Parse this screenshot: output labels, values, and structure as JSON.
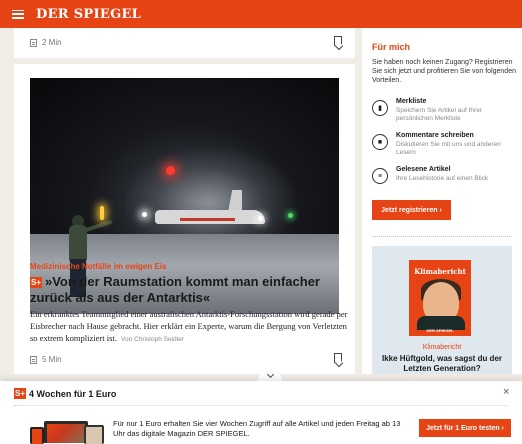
{
  "header": {
    "logo": "DER SPIEGEL",
    "menu_icon": "hamburger-menu-icon",
    "brand_color": "#e64415"
  },
  "top_card": {
    "read_time": "2 Min",
    "bookmark_icon": "bookmark-icon",
    "doc_icon": "article-document-icon"
  },
  "article": {
    "kicker": "Medizinische Notfälle im ewigen Eis",
    "badge": "S+",
    "headline": "»Von der Raumstation kommt man einfacher zurück als aus der Antarktis«",
    "teaser": "Ein erkranktes Teammitglied einer australischen Antarktis-Forschungsstation wird gerade per Eisbrecher nach Hause gebracht. Hier erklärt ein Experte, warum die Bergung von Verletzten so extrem kompliziert ist.",
    "byline": "Von Christoph Seidler",
    "read_time": "5 Min"
  },
  "sidebar": {
    "title": "Für mich",
    "intro": "Sie haben noch keinen Zugang? Registrieren Sie sich jetzt und profitieren Sie von folgenden Vorteilen.",
    "benefits": [
      {
        "title": "Merkliste",
        "desc": "Speichern Sie Artikel auf Ihrer persönlichen Merkliste",
        "icon": "bookmark-icon"
      },
      {
        "title": "Kommentare schreiben",
        "desc": "Diskutieren Sie mit uns und anderen Lesern",
        "icon": "comment-icon"
      },
      {
        "title": "Gelesene Artikel",
        "desc": "Ihre Lesehistorie auf einen Blick",
        "icon": "read-history-icon"
      }
    ],
    "cta": "Jetzt registrieren ›",
    "promo": {
      "cover_title": "Klimabericht",
      "cover_brand": "DER SPIEGEL",
      "kicker": "Klimabericht",
      "title": "Ikke Hüftgold, was sagst du der Letzten Generation?"
    }
  },
  "banner": {
    "badge": "S+",
    "title": "4 Wochen für 1 Euro",
    "close": "×",
    "text": "Für nur 1 Euro erhalten Sie vier Wochen Zugriff auf alle Artikel und jeden Freitag ab 13 Uhr das digitale Magazin DER SPIEGEL.",
    "cta": "Jetzt für 1 Euro testen ›"
  }
}
